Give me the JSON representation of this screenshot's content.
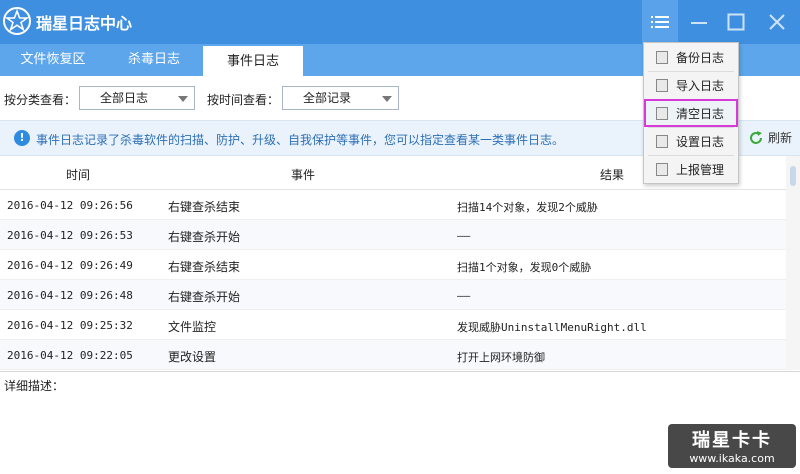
{
  "app": {
    "title": "瑞星日志中心"
  },
  "tabs": [
    {
      "label": "文件恢复区"
    },
    {
      "label": "杀毒日志"
    },
    {
      "label": "事件日志"
    }
  ],
  "filters": {
    "category_label": "按分类查看：",
    "category_value": "全部日志",
    "time_label": "按时间查看：",
    "time_value": "全部记录"
  },
  "info": {
    "text": "事件日志记录了杀毒软件的扫描、防护、升级、自我保护等事件，您可以指定查看某一类事件日志。",
    "refresh_label": "刷新"
  },
  "table": {
    "headers": {
      "time": "时间",
      "event": "事件",
      "result": "结果"
    },
    "rows": [
      {
        "time": "2016-04-12 09:26:56",
        "event": "右键查杀结束",
        "result": "扫描14个对象，发现2个威胁"
      },
      {
        "time": "2016-04-12 09:26:53",
        "event": "右键查杀开始",
        "result": "——"
      },
      {
        "time": "2016-04-12 09:26:49",
        "event": "右键查杀结束",
        "result": "扫描1个对象，发现0个威胁"
      },
      {
        "time": "2016-04-12 09:26:48",
        "event": "右键查杀开始",
        "result": "——"
      },
      {
        "time": "2016-04-12 09:25:32",
        "event": "文件监控",
        "result": "发现威胁UninstallMenuRight.dll"
      },
      {
        "time": "2016-04-12 09:22:05",
        "event": "更改设置",
        "result": "打开上网环境防御"
      }
    ]
  },
  "detail": {
    "label": "详细描述："
  },
  "menu": {
    "items": [
      {
        "label": "备份日志",
        "icon": "backup-icon"
      },
      {
        "label": "导入日志",
        "icon": "import-icon"
      },
      {
        "label": "清空日志",
        "icon": "clear-icon",
        "highlighted": true
      },
      {
        "label": "设置日志",
        "icon": "settings-icon"
      },
      {
        "label": "上报管理",
        "icon": "upload-icon"
      }
    ]
  },
  "watermark": {
    "logo": "瑞星卡卡",
    "url": "www.ikaka.com"
  },
  "colors": {
    "titlebar": "#3f8fe0",
    "tabbar": "#5da6ec",
    "info_bg": "#eaf3fc",
    "info_text": "#2e6fb5",
    "highlight": "#d63ad8",
    "refresh_green": "#3aa93a"
  }
}
